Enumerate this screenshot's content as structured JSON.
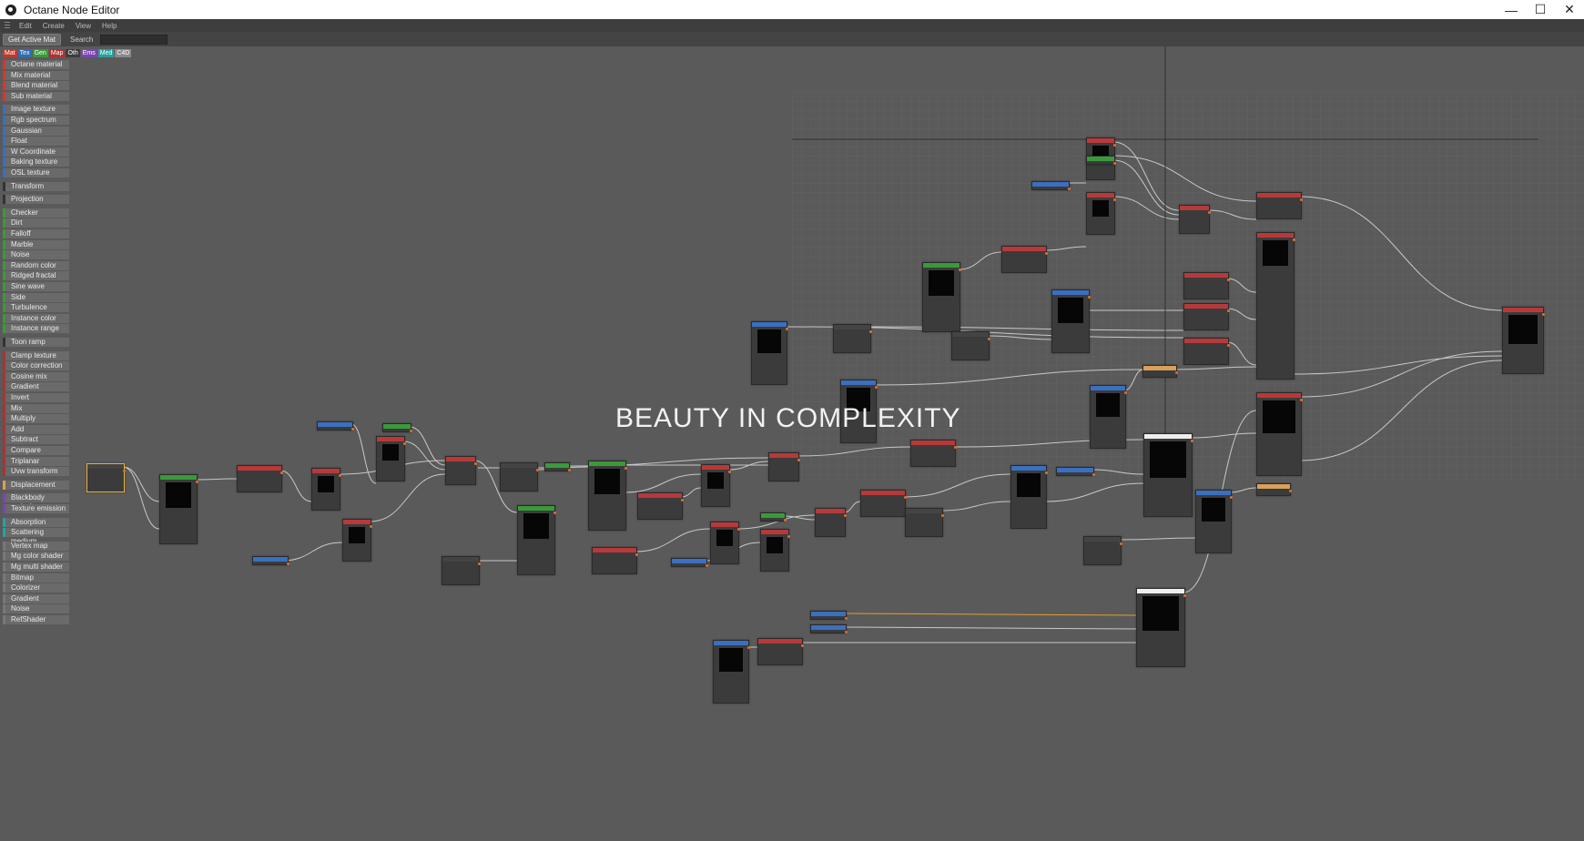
{
  "window": {
    "title": "Octane Node Editor",
    "controls": [
      "—",
      "☐",
      "✕"
    ]
  },
  "menu": [
    "Edit",
    "Create",
    "View",
    "Help"
  ],
  "toolbar": {
    "active_button": "Get Active Mat",
    "search_label": "Search",
    "search_value": ""
  },
  "tabs": [
    {
      "label": "Mat",
      "color": "#c0392b"
    },
    {
      "label": "Tex",
      "color": "#2f6db5"
    },
    {
      "label": "Gen",
      "color": "#3a9a3a"
    },
    {
      "label": "Map",
      "color": "#b03030"
    },
    {
      "label": "Oth",
      "color": "#3d3d3d"
    },
    {
      "label": "Ems",
      "color": "#7a45b0"
    },
    {
      "label": "Med",
      "color": "#2aa0a0"
    },
    {
      "label": "C4D",
      "color": "#8a8a8a"
    }
  ],
  "sidebar": [
    {
      "label": "Octane material",
      "color": "#d33"
    },
    {
      "label": "Mix material",
      "color": "#d33"
    },
    {
      "label": "Blend material",
      "color": "#d33"
    },
    {
      "label": "Sub material",
      "color": "#d33"
    },
    {
      "label": "Image texture",
      "color": "#3b6fc0"
    },
    {
      "label": "Rgb spectrum",
      "color": "#3b6fc0"
    },
    {
      "label": "Gaussian spectrum",
      "color": "#3b6fc0"
    },
    {
      "label": "Float",
      "color": "#3b6fc0"
    },
    {
      "label": "W Coordinate",
      "color": "#3b6fc0"
    },
    {
      "label": "Baking texture",
      "color": "#3b6fc0"
    },
    {
      "label": "OSL texture",
      "color": "#3b6fc0"
    },
    {
      "label": "Transform",
      "color": "#333"
    },
    {
      "label": "Projection",
      "color": "#333"
    },
    {
      "label": "Checker",
      "color": "#3a9a3a"
    },
    {
      "label": "Dirt",
      "color": "#3a9a3a"
    },
    {
      "label": "Falloff",
      "color": "#3a9a3a"
    },
    {
      "label": "Marble",
      "color": "#3a9a3a"
    },
    {
      "label": "Noise",
      "color": "#3a9a3a"
    },
    {
      "label": "Random color",
      "color": "#3a9a3a"
    },
    {
      "label": "Ridged fractal",
      "color": "#3a9a3a"
    },
    {
      "label": "Sine wave",
      "color": "#3a9a3a"
    },
    {
      "label": "Side",
      "color": "#3a9a3a"
    },
    {
      "label": "Turbulence",
      "color": "#3a9a3a"
    },
    {
      "label": "Instance color",
      "color": "#3a9a3a"
    },
    {
      "label": "Instance range",
      "color": "#3a9a3a"
    },
    {
      "label": "Toon ramp",
      "color": "#333"
    },
    {
      "label": "Clamp texture",
      "color": "#b03030"
    },
    {
      "label": "Color correction",
      "color": "#b03030"
    },
    {
      "label": "Cosine mix",
      "color": "#b03030"
    },
    {
      "label": "Gradient",
      "color": "#b03030"
    },
    {
      "label": "Invert",
      "color": "#b03030"
    },
    {
      "label": "Mix",
      "color": "#b03030"
    },
    {
      "label": "Multiply",
      "color": "#b03030"
    },
    {
      "label": "Add",
      "color": "#b03030"
    },
    {
      "label": "Subtract",
      "color": "#b03030"
    },
    {
      "label": "Compare",
      "color": "#b03030"
    },
    {
      "label": "Triplanar",
      "color": "#b03030"
    },
    {
      "label": "Uvw transform",
      "color": "#b03030"
    },
    {
      "label": "Displacement",
      "color": "#d8a05a"
    },
    {
      "label": "Blackbody emission",
      "color": "#7a45b0"
    },
    {
      "label": "Texture emission",
      "color": "#7a45b0"
    },
    {
      "label": "Absorption medium",
      "color": "#2aa0a0"
    },
    {
      "label": "Scattering medium",
      "color": "#2aa0a0"
    },
    {
      "label": "Vertex map",
      "color": "#777"
    },
    {
      "label": "Mg color shader",
      "color": "#777"
    },
    {
      "label": "Mg multi shader",
      "color": "#777"
    },
    {
      "label": "Bitmap",
      "color": "#777"
    },
    {
      "label": "Colorizer",
      "color": "#777"
    },
    {
      "label": "Gradient",
      "color": "#777"
    },
    {
      "label": "Noise",
      "color": "#777"
    },
    {
      "label": "RefShader",
      "color": "#777"
    }
  ],
  "canvas": {
    "overlay_text": "BEAUTY IN COMPLEXITY"
  }
}
